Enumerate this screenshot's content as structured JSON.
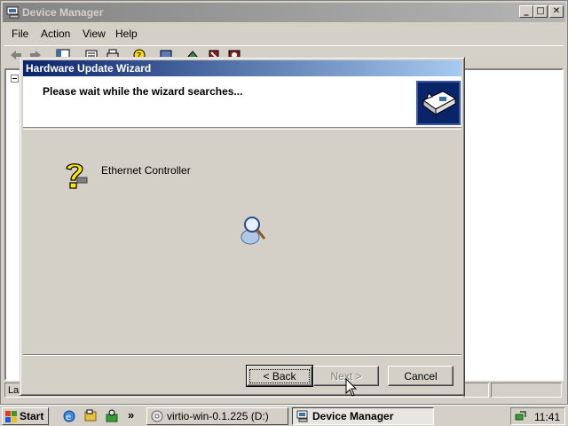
{
  "device_manager": {
    "title": "Device Manager",
    "controls": {
      "minimize": "_",
      "maximize": "□",
      "close": "✕"
    },
    "menu": [
      "File",
      "Action",
      "View",
      "Help"
    ],
    "status_text": "Lau"
  },
  "wizard": {
    "title": "Hardware Update Wizard",
    "heading": "Please wait while the wizard searches...",
    "device_name": "Ethernet Controller",
    "buttons": {
      "back": "< Back",
      "next": "Next >",
      "cancel": "Cancel"
    },
    "next_enabled": false
  },
  "taskbar": {
    "start_label": "Start",
    "chevron": "»",
    "tasks": [
      {
        "label": "virtio-win-0.1.225 (D:)",
        "active": false
      },
      {
        "label": "Device Manager",
        "active": true
      }
    ],
    "clock": "11:41"
  },
  "colors": {
    "desktop": "#3a6ea5",
    "active_title_start": "#0a246a",
    "active_title_end": "#a6caf0",
    "inactive_title": "#848484",
    "face": "#d4d0c8"
  }
}
